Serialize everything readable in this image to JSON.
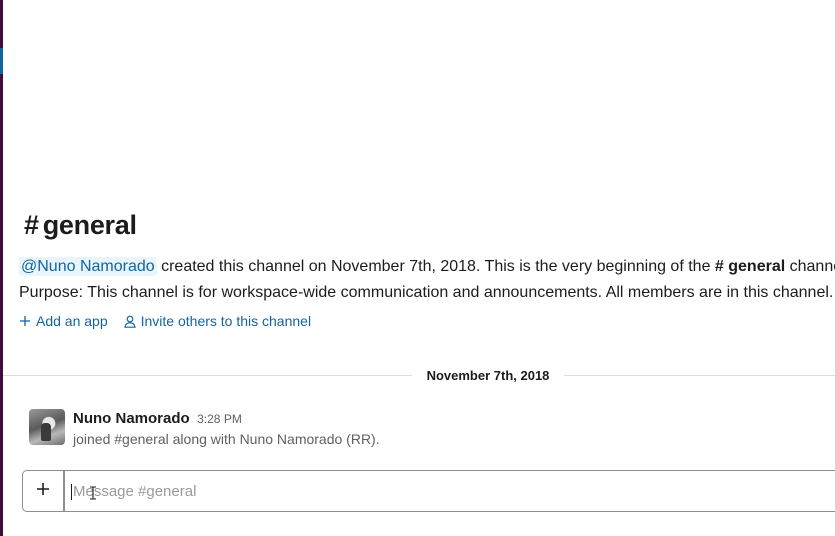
{
  "channel": {
    "hash": "#",
    "name": "general"
  },
  "intro": {
    "mention": "@Nuno Namorado",
    "text": " created this channel on November 7th, 2018. This is the very beginning of the ",
    "channel_ref": "# general",
    "channel_ref_suffix": " channel."
  },
  "purpose": {
    "text": "Purpose: This channel is for workspace-wide communication and announcements. All members are in this channel."
  },
  "actions": {
    "add_app": "Add an app",
    "invite": "Invite others to this channel"
  },
  "date_divider": "November 7th, 2018",
  "message": {
    "author": "Nuno Namorado",
    "time": "3:28 PM",
    "body": "joined #general along with Nuno Namorado (RR)."
  },
  "composer": {
    "placeholder": "Message #general"
  },
  "colors": {
    "link": "#1264a3",
    "mention_bg": "#e8f5fa",
    "sidebar": "#3f0e40",
    "text": "#1d1c1d",
    "muted": "#616061"
  }
}
